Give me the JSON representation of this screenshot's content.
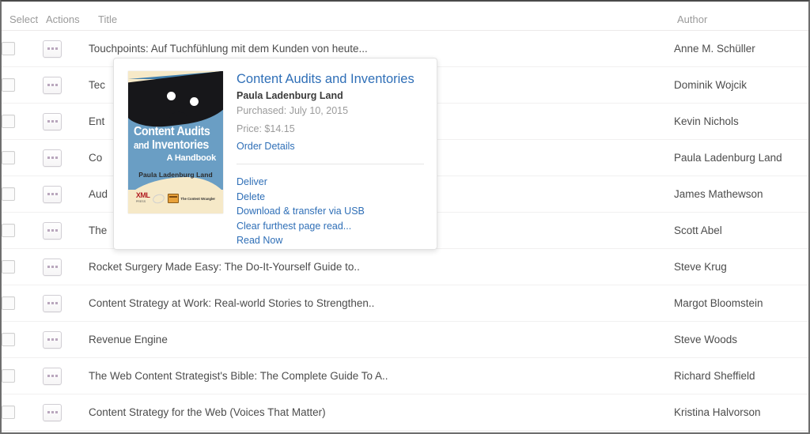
{
  "table": {
    "columns": [
      {
        "key": "select",
        "label": "Select"
      },
      {
        "key": "actions",
        "label": "Actions"
      },
      {
        "key": "title",
        "label": "Title"
      },
      {
        "key": "author",
        "label": "Author"
      }
    ],
    "rows": [
      {
        "title": "Touchpoints: Auf Tuchfühlung mit dem Kunden von heute...",
        "author": "Anne M. Schüller"
      },
      {
        "title": "Tec",
        "author": "Dominik Wojcik"
      },
      {
        "title": "Ent",
        "author": "Kevin Nichols"
      },
      {
        "title": "Co",
        "author": "Paula Ladenburg Land"
      },
      {
        "title": "Aud",
        "author": "James Mathewson"
      },
      {
        "title": "The",
        "author": "Scott Abel"
      },
      {
        "title": "Rocket Surgery Made Easy: The Do-It-Yourself Guide to..",
        "author": "Steve Krug"
      },
      {
        "title": "Content Strategy at Work: Real-world Stories to Strengthen..",
        "author": "Margot Bloomstein"
      },
      {
        "title": "Revenue Engine",
        "author": "Steve Woods"
      },
      {
        "title": "The Web Content Strategist's Bible: The Complete Guide To A..",
        "author": "Richard Sheffield"
      },
      {
        "title": "Content Strategy for the Web (Voices That Matter)",
        "author": "Kristina Halvorson"
      }
    ],
    "checkbox_icon": "checkbox-unchecked-icon",
    "actions_icon": "ellipsis-icon"
  },
  "popup": {
    "title": "Content Audits and Inventories",
    "author": "Paula Ladenburg Land",
    "purchased": "Purchased: July 10, 2015",
    "price": "Price: $14.15",
    "order_details_link": "Order Details",
    "actions": [
      "Deliver",
      "Delete",
      "Download & transfer via USB",
      "Clear furthest page read...",
      "Read Now"
    ],
    "cover": {
      "title_line_1": "Content Audits",
      "title_and": "and",
      "title_line_2": "Inventories",
      "subtitle": "A Handbook",
      "author": "Paula Ladenburg Land",
      "logo_primary": "XML",
      "logo_primary_sub": "PRESS",
      "logo_secondary": "The Content Wrangler"
    }
  },
  "colors": {
    "link": "#2f6fb7",
    "header_text": "#9a9a9a",
    "body_text": "#4d4d4d",
    "meta_text": "#9b9b9b",
    "row_border": "#f1f0f0",
    "cover_blue": "#6a9ec4",
    "cover_cream": "#f6e9c8",
    "cover_dark": "#17171a"
  }
}
